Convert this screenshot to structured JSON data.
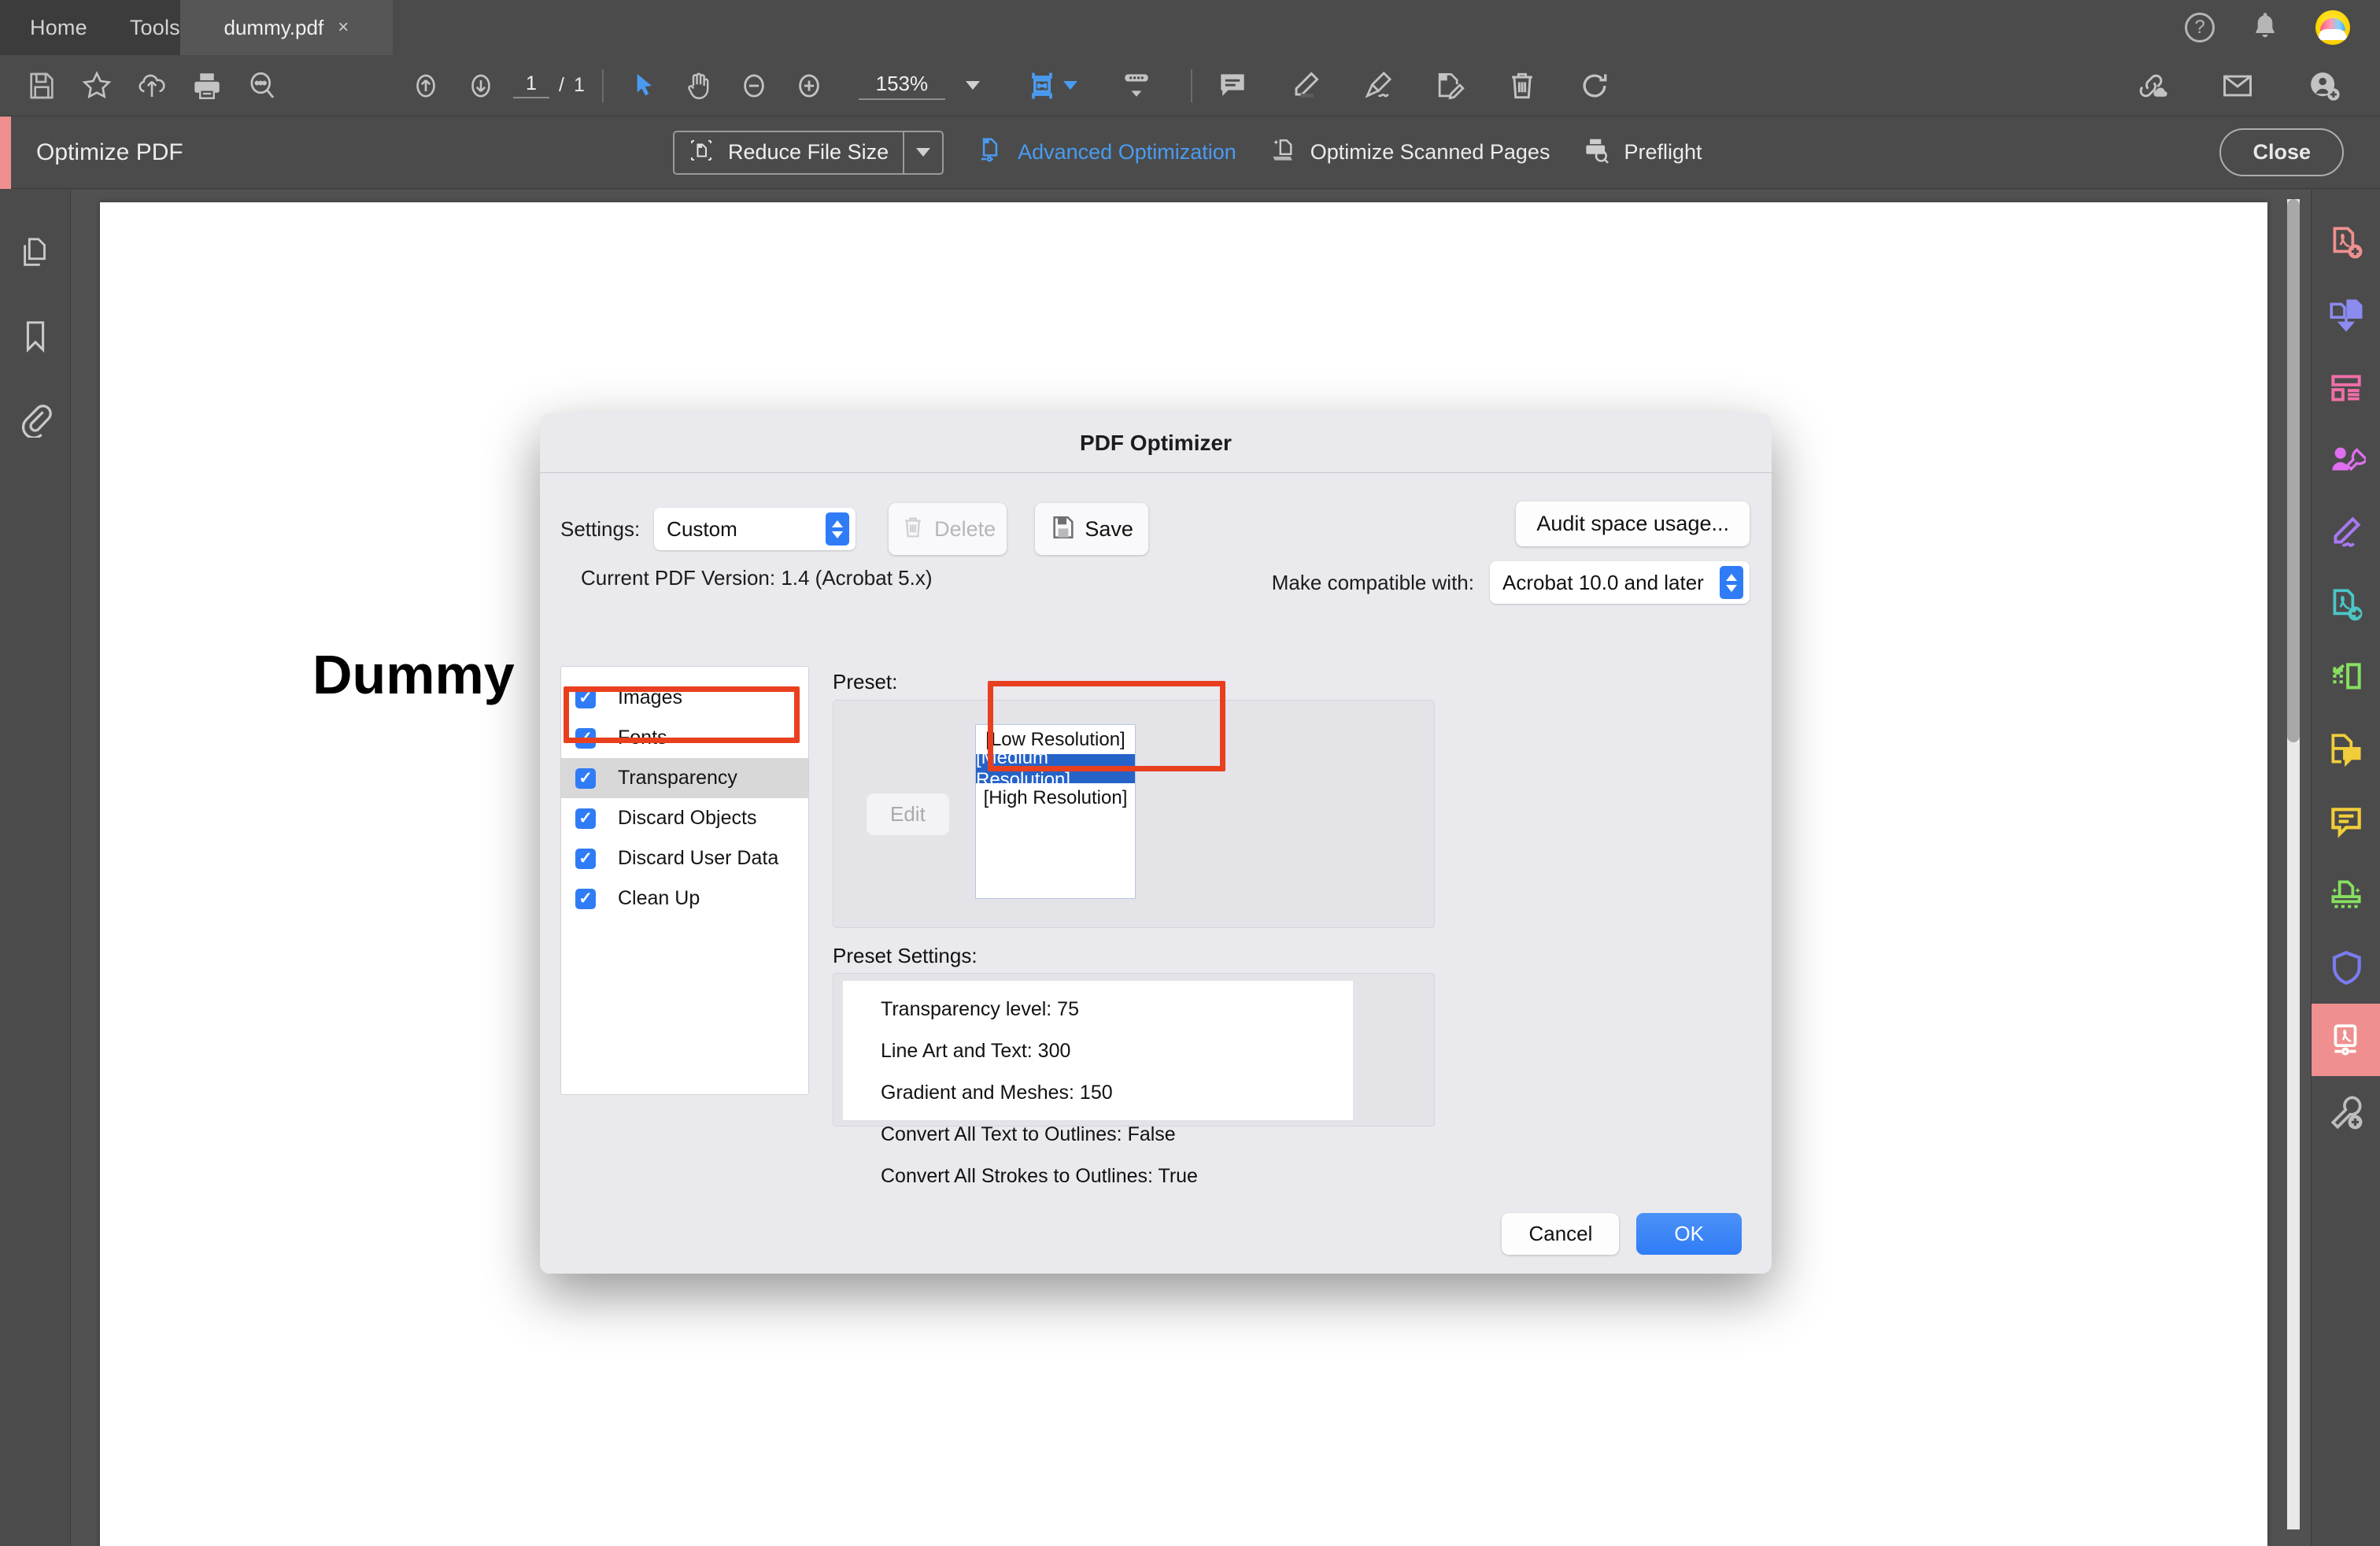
{
  "tabbar": {
    "home_label": "Home",
    "tools_label": "Tools",
    "doc_tab_title": "dummy.pdf",
    "doc_tab_close": "×",
    "help_label": "?"
  },
  "toolbar": {
    "page_current": "1",
    "page_separator": "/",
    "page_total": "1",
    "zoom_level": "153%",
    "icons": [
      "save-icon",
      "star-icon",
      "upload-cloud-icon",
      "print-icon",
      "search-icon",
      "page-up-icon",
      "page-down-icon",
      "select-cursor-icon",
      "hand-tool-icon",
      "zoom-out-icon",
      "zoom-in-icon",
      "fit-page-icon",
      "scroll-mode-icon",
      "comment-icon",
      "highlight-icon",
      "sign-icon",
      "edit-pdf-icon",
      "delete-icon",
      "rotate-icon",
      "share-link-icon",
      "email-icon",
      "add-person-icon"
    ]
  },
  "optimize_bar": {
    "title": "Optimize PDF",
    "reduce_file_size": "Reduce File Size",
    "advanced_optimization": "Advanced Optimization",
    "optimize_scanned_pages": "Optimize Scanned Pages",
    "preflight": "Preflight",
    "close": "Close"
  },
  "left_rail": {
    "items": [
      "page-thumbnails-icon",
      "bookmarks-icon",
      "attachments-icon"
    ]
  },
  "right_rail": {
    "items": [
      {
        "name": "create-pdf-icon",
        "color": "#ef8f8f"
      },
      {
        "name": "combine-files-icon",
        "color": "#8b8bf0"
      },
      {
        "name": "organize-pages-icon",
        "color": "#f06fa8"
      },
      {
        "name": "request-signature-icon",
        "color": "#e06ff0"
      },
      {
        "name": "fill-and-sign-icon",
        "color": "#a878f0"
      },
      {
        "name": "export-pdf-icon",
        "color": "#4cc6c6"
      },
      {
        "name": "crop-pages-icon",
        "color": "#86e060"
      },
      {
        "name": "add-comment-icon",
        "color": "#f2cd3a"
      },
      {
        "name": "comment-bubble-icon",
        "color": "#f2cd3a"
      },
      {
        "name": "scan-and-ocr-icon",
        "color": "#86e060"
      },
      {
        "name": "protect-icon",
        "color": "#7b7bf0"
      },
      {
        "name": "optimize-pdf-icon",
        "color": "#ffffff"
      },
      {
        "name": "more-tools-icon",
        "color": "#bdbdbd"
      }
    ]
  },
  "document": {
    "heading": "Dummy"
  },
  "dialog": {
    "title": "PDF Optimizer",
    "settings_label": "Settings:",
    "settings_value": "Custom",
    "delete_label": "Delete",
    "save_label": "Save",
    "audit_label": "Audit space usage...",
    "current_version": "Current PDF Version: 1.4 (Acrobat 5.x)",
    "compatible_label": "Make compatible with:",
    "compatible_value": "Acrobat 10.0 and later",
    "checklist": [
      {
        "label": "Images",
        "checked": true,
        "selected": false
      },
      {
        "label": "Fonts",
        "checked": true,
        "selected": false
      },
      {
        "label": "Transparency",
        "checked": true,
        "selected": true
      },
      {
        "label": "Discard Objects",
        "checked": true,
        "selected": false
      },
      {
        "label": "Discard User Data",
        "checked": true,
        "selected": false
      },
      {
        "label": "Clean Up",
        "checked": true,
        "selected": false
      }
    ],
    "preset_label": "Preset:",
    "edit_label": "Edit",
    "preset_options": [
      {
        "label": "[Low Resolution]",
        "selected": false
      },
      {
        "label": "[Medium Resolution]",
        "selected": true
      },
      {
        "label": "[High Resolution]",
        "selected": false
      }
    ],
    "preset_settings_label": "Preset Settings:",
    "preset_settings": [
      "Transparency level: 75",
      "Line Art and Text: 300",
      "Gradient and Meshes: 150",
      "Convert All Text to Outlines: False",
      "Convert All Strokes to Outlines: True"
    ],
    "cancel_label": "Cancel",
    "ok_label": "OK"
  },
  "colors": {
    "accent_blue": "#2f7cf6",
    "annotation_red": "#e8401f",
    "active_tool_pink": "#ef8f8f",
    "link_blue": "#4a9bf0",
    "selection_blue": "#2563c9"
  }
}
